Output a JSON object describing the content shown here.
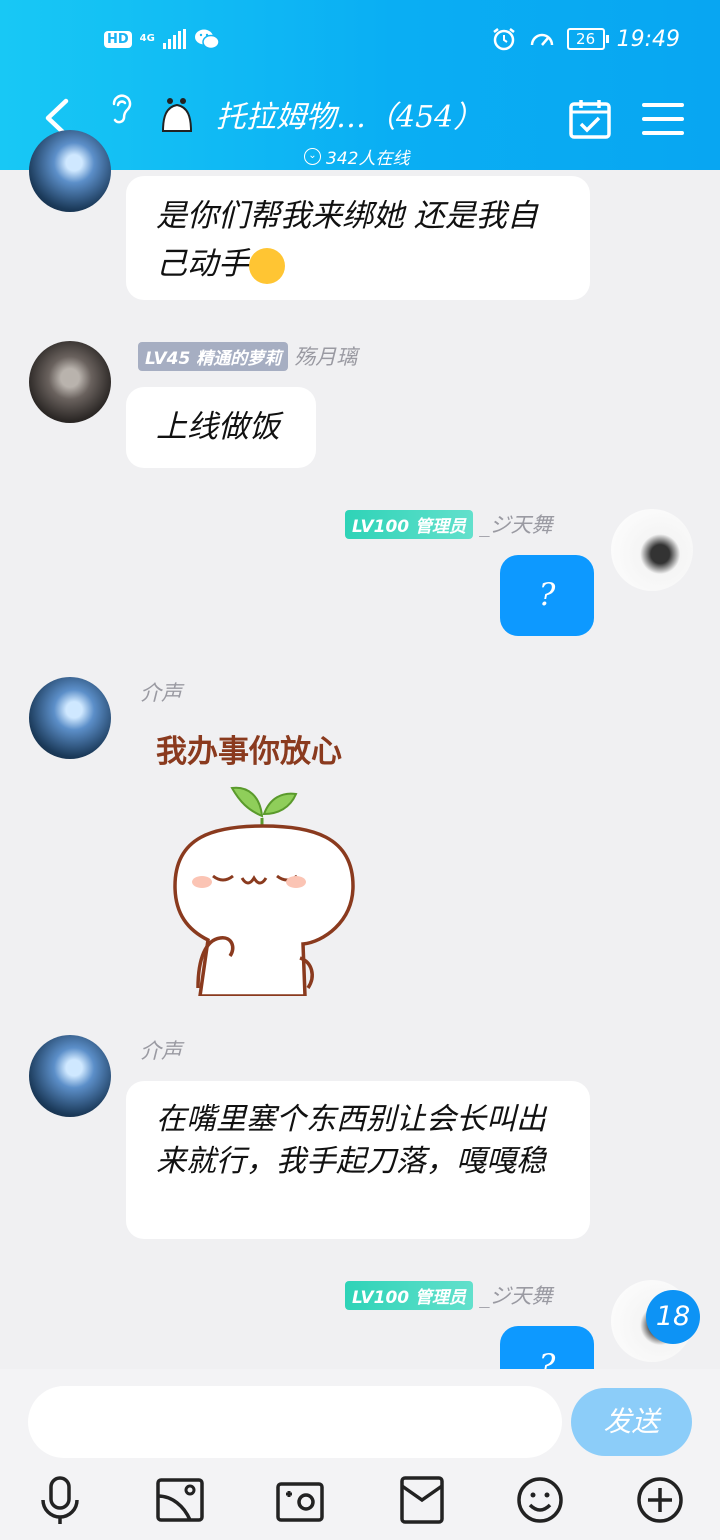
{
  "status_bar": {
    "hd": "HD",
    "network": "4G",
    "battery": "26",
    "time": "19:49"
  },
  "header": {
    "title": "托拉姆物…（454）",
    "online": "342人在线"
  },
  "messages": [
    {
      "bubble": "是你们帮我来绑她  还是我自己动手"
    },
    {
      "level": "LV45 精通的萝莉",
      "name": "殇月璃",
      "bubble": "上线做饭"
    },
    {
      "level": "LV100 管理员",
      "name": "_ジ天舞",
      "bubble": "?"
    },
    {
      "name": "介声",
      "sticker_text": "我办事你放心"
    },
    {
      "name": "介声",
      "bubble": "在嘴里塞个东西别让会长叫出来就行，我手起刀落，嘎嘎稳"
    },
    {
      "level": "LV100 管理员",
      "name": "_ジ天舞",
      "bubble": "?"
    }
  ],
  "unread_badge": "18",
  "composer": {
    "input_value": "",
    "send_label": "发送"
  },
  "toolbar_icons": [
    "microphone-icon",
    "image-icon",
    "camera-icon",
    "red-packet-icon",
    "emoji-icon",
    "plus-icon"
  ]
}
